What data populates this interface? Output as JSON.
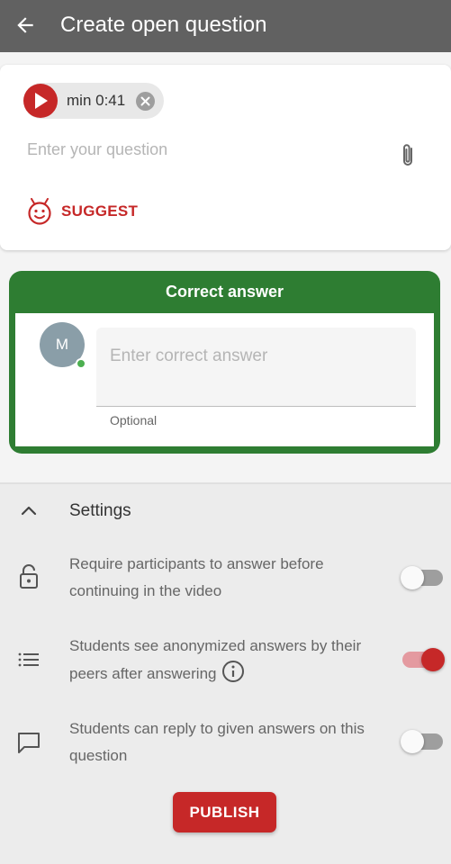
{
  "header": {
    "title": "Create open question",
    "back_icon": "arrow-left-icon",
    "background": "#616161"
  },
  "question": {
    "media_chip": {
      "label": "min 0:41",
      "play_icon": "play-icon",
      "remove_icon": "close-circle-icon"
    },
    "input_placeholder": "Enter your question",
    "attach_icon": "paperclip-icon",
    "suggest": {
      "label": "SUGGEST",
      "icon": "robot-face-icon"
    }
  },
  "correct_answer": {
    "header": "Correct answer",
    "avatar_initial": "M",
    "input_placeholder": "Enter correct answer",
    "helper": "Optional",
    "accent": "#2e7d32"
  },
  "settings": {
    "title": "Settings",
    "collapse_icon": "chevron-up-icon",
    "options": [
      {
        "icon": "lock-icon",
        "text": "Require participants to answer before continuing in the video",
        "enabled": false
      },
      {
        "icon": "list-icon",
        "text": "Students see anonymized answers by their peers after answering",
        "info_icon": "info-icon",
        "enabled": true
      },
      {
        "icon": "comment-icon",
        "text": "Students can reply to given answers on this question",
        "enabled": false
      }
    ]
  },
  "actions": {
    "publish_label": "PUBLISH"
  },
  "colors": {
    "primary": "#c62828",
    "toggle_on_track": "#e49aa0",
    "toggle_off_track": "#9e9e9e"
  }
}
